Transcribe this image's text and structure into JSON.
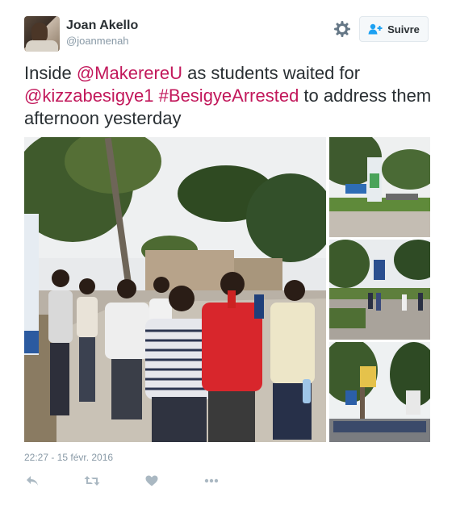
{
  "user": {
    "name": "Joan Akello",
    "handle": "@joanmenah"
  },
  "header": {
    "follow_label": "Suivre"
  },
  "tweet": {
    "parts": [
      {
        "text": "Inside ",
        "link": false
      },
      {
        "text": "@MakerereU",
        "link": true
      },
      {
        "text": " as students waited for ",
        "link": false
      },
      {
        "text": "@kizzabesigye1",
        "link": true
      },
      {
        "text": " ",
        "link": false
      },
      {
        "text": "#BesigyeArrested",
        "link": true
      },
      {
        "text": " to address them afternoon yesterday",
        "link": false
      }
    ],
    "timestamp": "22:27 - 15 févr. 2016"
  },
  "colors": {
    "accent": "#c2185b",
    "muted": "#8899a6",
    "text": "#292f33"
  },
  "actions": [
    "reply-icon",
    "retweet-icon",
    "like-icon",
    "more-icon"
  ]
}
